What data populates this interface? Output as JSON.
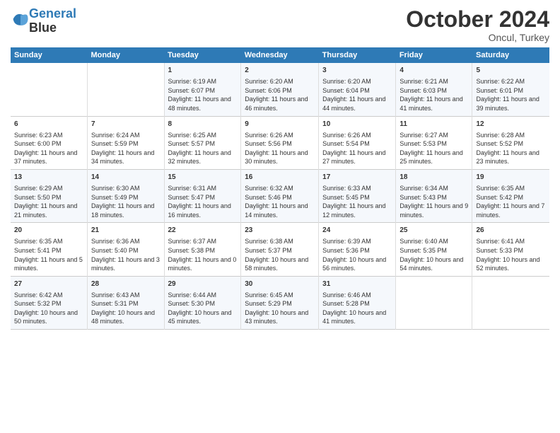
{
  "logo": {
    "line1": "General",
    "line2": "Blue"
  },
  "title": "October 2024",
  "subtitle": "Oncul, Turkey",
  "days_header": [
    "Sunday",
    "Monday",
    "Tuesday",
    "Wednesday",
    "Thursday",
    "Friday",
    "Saturday"
  ],
  "weeks": [
    [
      {
        "day": "",
        "sunrise": "",
        "sunset": "",
        "daylight": ""
      },
      {
        "day": "",
        "sunrise": "",
        "sunset": "",
        "daylight": ""
      },
      {
        "day": "1",
        "sunrise": "Sunrise: 6:19 AM",
        "sunset": "Sunset: 6:07 PM",
        "daylight": "Daylight: 11 hours and 48 minutes."
      },
      {
        "day": "2",
        "sunrise": "Sunrise: 6:20 AM",
        "sunset": "Sunset: 6:06 PM",
        "daylight": "Daylight: 11 hours and 46 minutes."
      },
      {
        "day": "3",
        "sunrise": "Sunrise: 6:20 AM",
        "sunset": "Sunset: 6:04 PM",
        "daylight": "Daylight: 11 hours and 44 minutes."
      },
      {
        "day": "4",
        "sunrise": "Sunrise: 6:21 AM",
        "sunset": "Sunset: 6:03 PM",
        "daylight": "Daylight: 11 hours and 41 minutes."
      },
      {
        "day": "5",
        "sunrise": "Sunrise: 6:22 AM",
        "sunset": "Sunset: 6:01 PM",
        "daylight": "Daylight: 11 hours and 39 minutes."
      }
    ],
    [
      {
        "day": "6",
        "sunrise": "Sunrise: 6:23 AM",
        "sunset": "Sunset: 6:00 PM",
        "daylight": "Daylight: 11 hours and 37 minutes."
      },
      {
        "day": "7",
        "sunrise": "Sunrise: 6:24 AM",
        "sunset": "Sunset: 5:59 PM",
        "daylight": "Daylight: 11 hours and 34 minutes."
      },
      {
        "day": "8",
        "sunrise": "Sunrise: 6:25 AM",
        "sunset": "Sunset: 5:57 PM",
        "daylight": "Daylight: 11 hours and 32 minutes."
      },
      {
        "day": "9",
        "sunrise": "Sunrise: 6:26 AM",
        "sunset": "Sunset: 5:56 PM",
        "daylight": "Daylight: 11 hours and 30 minutes."
      },
      {
        "day": "10",
        "sunrise": "Sunrise: 6:26 AM",
        "sunset": "Sunset: 5:54 PM",
        "daylight": "Daylight: 11 hours and 27 minutes."
      },
      {
        "day": "11",
        "sunrise": "Sunrise: 6:27 AM",
        "sunset": "Sunset: 5:53 PM",
        "daylight": "Daylight: 11 hours and 25 minutes."
      },
      {
        "day": "12",
        "sunrise": "Sunrise: 6:28 AM",
        "sunset": "Sunset: 5:52 PM",
        "daylight": "Daylight: 11 hours and 23 minutes."
      }
    ],
    [
      {
        "day": "13",
        "sunrise": "Sunrise: 6:29 AM",
        "sunset": "Sunset: 5:50 PM",
        "daylight": "Daylight: 11 hours and 21 minutes."
      },
      {
        "day": "14",
        "sunrise": "Sunrise: 6:30 AM",
        "sunset": "Sunset: 5:49 PM",
        "daylight": "Daylight: 11 hours and 18 minutes."
      },
      {
        "day": "15",
        "sunrise": "Sunrise: 6:31 AM",
        "sunset": "Sunset: 5:47 PM",
        "daylight": "Daylight: 11 hours and 16 minutes."
      },
      {
        "day": "16",
        "sunrise": "Sunrise: 6:32 AM",
        "sunset": "Sunset: 5:46 PM",
        "daylight": "Daylight: 11 hours and 14 minutes."
      },
      {
        "day": "17",
        "sunrise": "Sunrise: 6:33 AM",
        "sunset": "Sunset: 5:45 PM",
        "daylight": "Daylight: 11 hours and 12 minutes."
      },
      {
        "day": "18",
        "sunrise": "Sunrise: 6:34 AM",
        "sunset": "Sunset: 5:43 PM",
        "daylight": "Daylight: 11 hours and 9 minutes."
      },
      {
        "day": "19",
        "sunrise": "Sunrise: 6:35 AM",
        "sunset": "Sunset: 5:42 PM",
        "daylight": "Daylight: 11 hours and 7 minutes."
      }
    ],
    [
      {
        "day": "20",
        "sunrise": "Sunrise: 6:35 AM",
        "sunset": "Sunset: 5:41 PM",
        "daylight": "Daylight: 11 hours and 5 minutes."
      },
      {
        "day": "21",
        "sunrise": "Sunrise: 6:36 AM",
        "sunset": "Sunset: 5:40 PM",
        "daylight": "Daylight: 11 hours and 3 minutes."
      },
      {
        "day": "22",
        "sunrise": "Sunrise: 6:37 AM",
        "sunset": "Sunset: 5:38 PM",
        "daylight": "Daylight: 11 hours and 0 minutes."
      },
      {
        "day": "23",
        "sunrise": "Sunrise: 6:38 AM",
        "sunset": "Sunset: 5:37 PM",
        "daylight": "Daylight: 10 hours and 58 minutes."
      },
      {
        "day": "24",
        "sunrise": "Sunrise: 6:39 AM",
        "sunset": "Sunset: 5:36 PM",
        "daylight": "Daylight: 10 hours and 56 minutes."
      },
      {
        "day": "25",
        "sunrise": "Sunrise: 6:40 AM",
        "sunset": "Sunset: 5:35 PM",
        "daylight": "Daylight: 10 hours and 54 minutes."
      },
      {
        "day": "26",
        "sunrise": "Sunrise: 6:41 AM",
        "sunset": "Sunset: 5:33 PM",
        "daylight": "Daylight: 10 hours and 52 minutes."
      }
    ],
    [
      {
        "day": "27",
        "sunrise": "Sunrise: 6:42 AM",
        "sunset": "Sunset: 5:32 PM",
        "daylight": "Daylight: 10 hours and 50 minutes."
      },
      {
        "day": "28",
        "sunrise": "Sunrise: 6:43 AM",
        "sunset": "Sunset: 5:31 PM",
        "daylight": "Daylight: 10 hours and 48 minutes."
      },
      {
        "day": "29",
        "sunrise": "Sunrise: 6:44 AM",
        "sunset": "Sunset: 5:30 PM",
        "daylight": "Daylight: 10 hours and 45 minutes."
      },
      {
        "day": "30",
        "sunrise": "Sunrise: 6:45 AM",
        "sunset": "Sunset: 5:29 PM",
        "daylight": "Daylight: 10 hours and 43 minutes."
      },
      {
        "day": "31",
        "sunrise": "Sunrise: 6:46 AM",
        "sunset": "Sunset: 5:28 PM",
        "daylight": "Daylight: 10 hours and 41 minutes."
      },
      {
        "day": "",
        "sunrise": "",
        "sunset": "",
        "daylight": ""
      },
      {
        "day": "",
        "sunrise": "",
        "sunset": "",
        "daylight": ""
      }
    ]
  ]
}
